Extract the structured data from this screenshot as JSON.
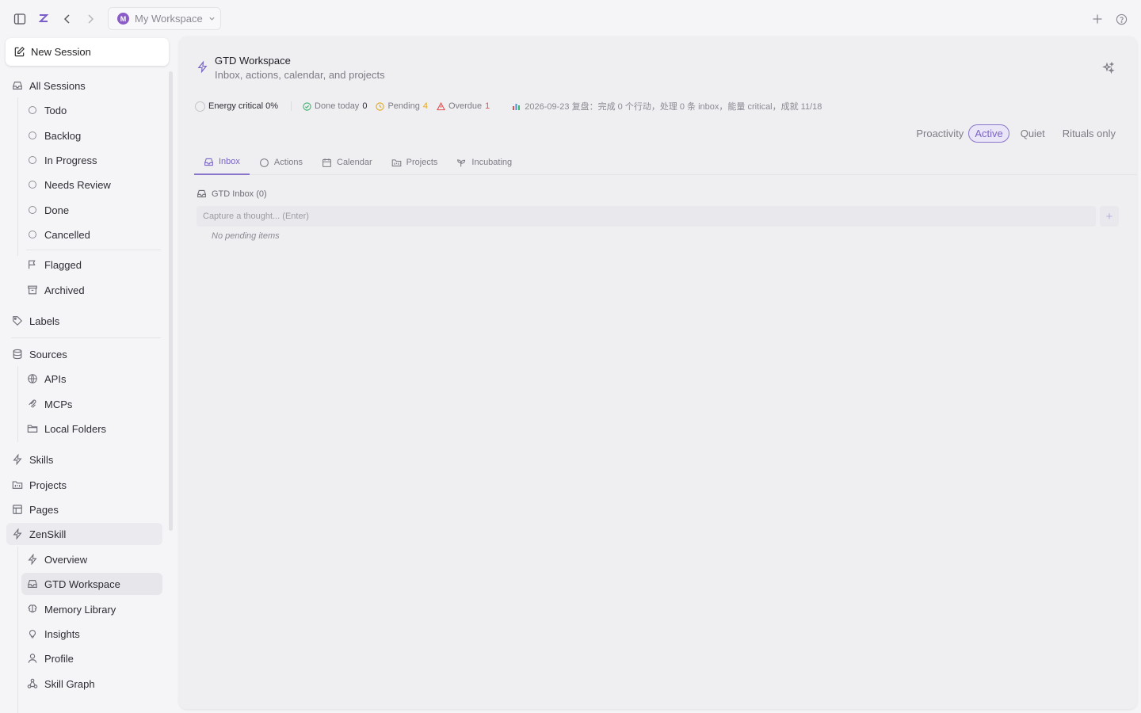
{
  "topbar": {
    "workspace": {
      "initial": "M",
      "name": "My Workspace"
    }
  },
  "sidebar": {
    "new_session": "New Session",
    "all_sessions": "All Sessions",
    "statuses": [
      "Todo",
      "Backlog",
      "In Progress",
      "Needs Review",
      "Done",
      "Cancelled"
    ],
    "flagged": "Flagged",
    "archived": "Archived",
    "labels": "Labels",
    "sources": "Sources",
    "source_items": [
      "APIs",
      "MCPs",
      "Local Folders"
    ],
    "skills": "Skills",
    "projects": "Projects",
    "pages": "Pages",
    "zenskill": "ZenSkill",
    "zen_items": [
      "Overview",
      "GTD Workspace",
      "Memory Library",
      "Insights",
      "Profile",
      "Skill Graph"
    ]
  },
  "main": {
    "title": "GTD Workspace",
    "subtitle": "Inbox, actions, calendar, and projects",
    "status": {
      "energy": "Energy critical 0%",
      "done_label": "Done today",
      "done_count": "0",
      "pending_label": "Pending",
      "pending_count": "4",
      "overdue_label": "Overdue",
      "overdue_count": "1",
      "review": "2026-09-23 复盘：完成 0 个行动，处理 0 条 inbox，能量 critical，成就 11/18"
    },
    "proactivity": {
      "label": "Proactivity",
      "options": [
        "Active",
        "Quiet",
        "Rituals only"
      ],
      "selected": "Active"
    },
    "tabs": [
      "Inbox",
      "Actions",
      "Calendar",
      "Projects",
      "Incubating"
    ],
    "active_tab": "Inbox",
    "inbox_header": "GTD Inbox (0)",
    "capture_placeholder": "Capture a thought... (Enter)",
    "add_symbol": "+",
    "empty_text": "No pending items"
  },
  "colors": {
    "accent": "#7a64c4",
    "done": "#3cb371",
    "pending": "#e6a817",
    "overdue": "#e05252"
  }
}
